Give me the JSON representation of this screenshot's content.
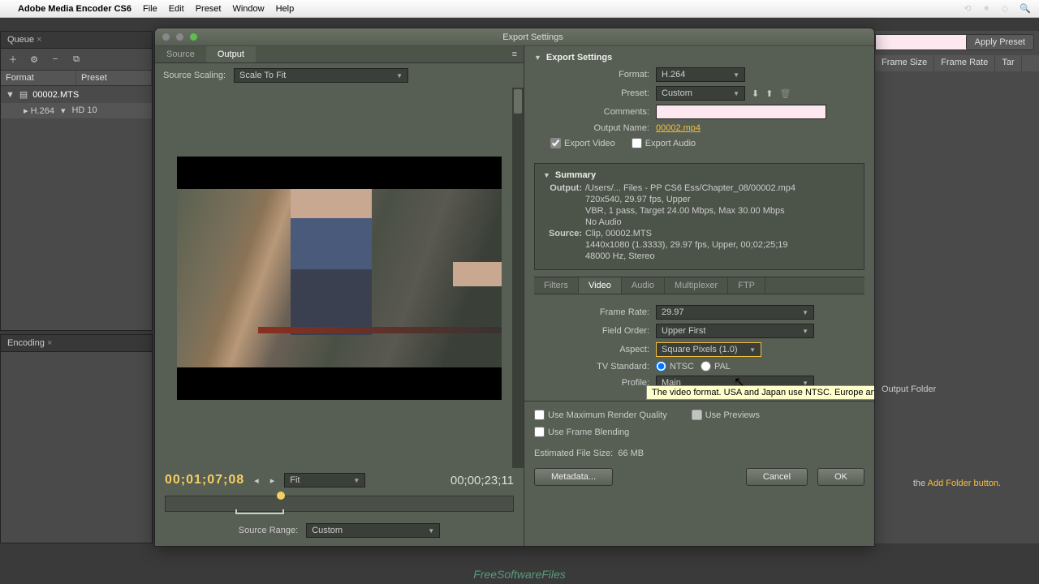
{
  "menubar": {
    "app": "Adobe Media Encoder CS6",
    "items": [
      "File",
      "Edit",
      "Preset",
      "Window",
      "Help"
    ]
  },
  "queue": {
    "tab": "Queue",
    "headers": {
      "format": "Format",
      "preset": "Preset"
    },
    "item": "00002.MTS",
    "sub_format": "H.264",
    "sub_preset": "HD 10"
  },
  "encoding": {
    "tab": "Encoding"
  },
  "export": {
    "title": "Export Settings",
    "src_tabs": {
      "source": "Source",
      "output": "Output"
    },
    "scaling_label": "Source Scaling:",
    "scaling_value": "Scale To Fit",
    "timecode": "00;01;07;08",
    "duration": "00;00;23;11",
    "fit": "Fit",
    "range_label": "Source Range:",
    "range_value": "Custom",
    "section_title": "Export Settings",
    "format_label": "Format:",
    "format_value": "H.264",
    "preset_label": "Preset:",
    "preset_value": "Custom",
    "comments_label": "Comments:",
    "outname_label": "Output Name:",
    "outname_value": "00002.mp4",
    "export_video": "Export Video",
    "export_audio": "Export Audio",
    "summary": {
      "title": "Summary",
      "output_label": "Output:",
      "out1": "/Users/... Files - PP CS6 Ess/Chapter_08/00002.mp4",
      "out2": "720x540, 29.97 fps, Upper",
      "out3": "VBR, 1 pass, Target 24.00 Mbps, Max 30.00 Mbps",
      "out4": "No Audio",
      "source_label": "Source:",
      "src1": "Clip, 00002.MTS",
      "src2": "1440x1080 (1.3333), 29.97 fps, Upper, 00;02;25;19",
      "src3": "48000 Hz, Stereo"
    },
    "tabs": {
      "filters": "Filters",
      "video": "Video",
      "audio": "Audio",
      "multiplexer": "Multiplexer",
      "ftp": "FTP"
    },
    "video": {
      "framerate_label": "Frame Rate:",
      "framerate_value": "29.97",
      "fieldorder_label": "Field Order:",
      "fieldorder_value": "Upper First",
      "aspect_label": "Aspect:",
      "aspect_value": "Square Pixels (1.0)",
      "tvstd_label": "TV Standard:",
      "ntsc": "NTSC",
      "pal": "PAL",
      "profile_label": "Profile:",
      "profile_value": "Main",
      "tooltip": "The video format. USA and Japan use NTSC. Europe and Asia use PAL."
    },
    "opts": {
      "maxq": "Use Maximum Render Quality",
      "previews": "Use Previews",
      "blend": "Use Frame Blending"
    },
    "est_label": "Estimated File Size:",
    "est_value": "66 MB",
    "buttons": {
      "metadata": "Metadata...",
      "cancel": "Cancel",
      "ok": "OK"
    }
  },
  "right": {
    "apply": "Apply Preset",
    "cols": {
      "frame_size": "Frame Size",
      "frame_rate": "Frame Rate",
      "tar": "Tar"
    },
    "output_folder": "Output Folder",
    "hint_pre": "the ",
    "hint_link": "Add Folder button."
  },
  "watermark": "FreeSoftwareFiles"
}
